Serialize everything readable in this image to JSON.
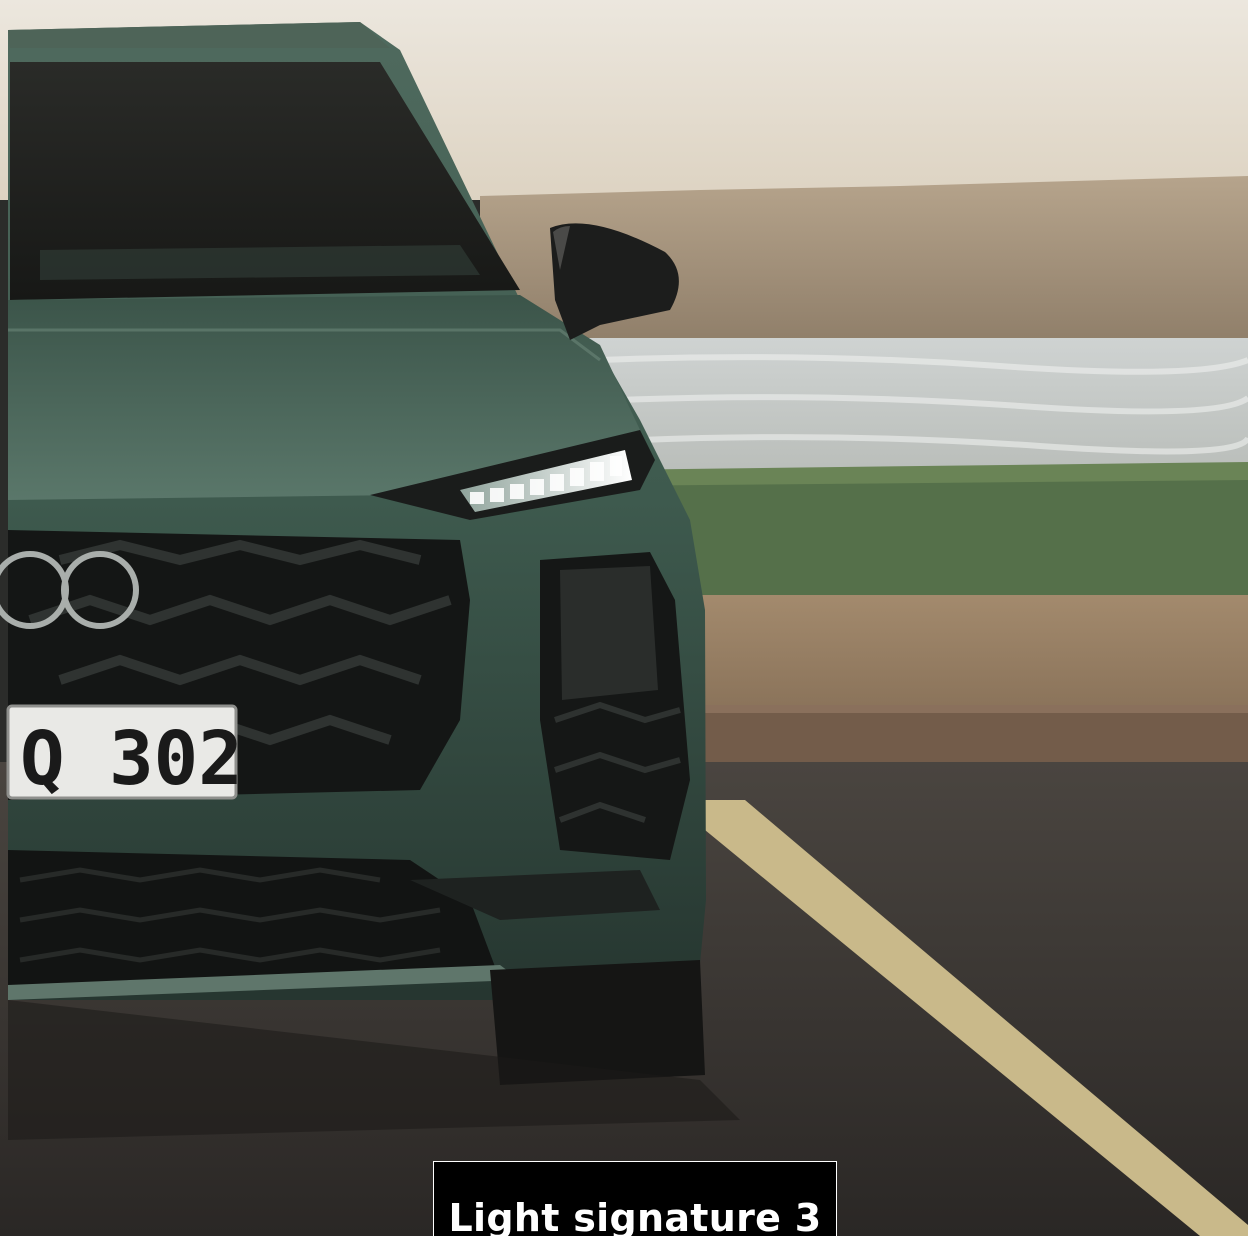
{
  "image": {
    "plate_text": "Q 302",
    "caption": "Light signature 3"
  },
  "colors": {
    "sky": "#e9e4da",
    "sea": "#d6d8d6",
    "grass": "#56704a",
    "sand": "#a68e72",
    "asphalt": "#3b3733",
    "car_body": "#3f5a4e",
    "caption_bg": "#000000",
    "caption_text": "#ffffff"
  }
}
